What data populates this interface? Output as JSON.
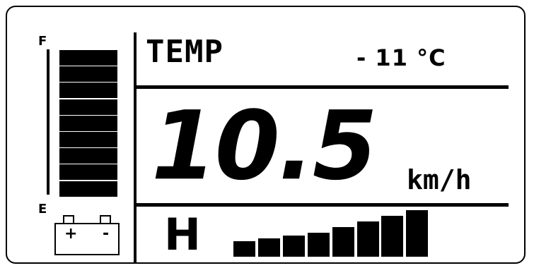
{
  "gauge": {
    "full_label": "F",
    "empty_label": "E",
    "segments_total": 9,
    "segments_filled": 9
  },
  "battery": {
    "plus": "+",
    "minus": "-"
  },
  "temperature": {
    "label": "TEMP",
    "value": "- 11 °C"
  },
  "speed": {
    "value": "10.5",
    "unit": "km/h"
  },
  "assist": {
    "mode": "H",
    "bars_total": 8,
    "bars_filled": 8
  }
}
